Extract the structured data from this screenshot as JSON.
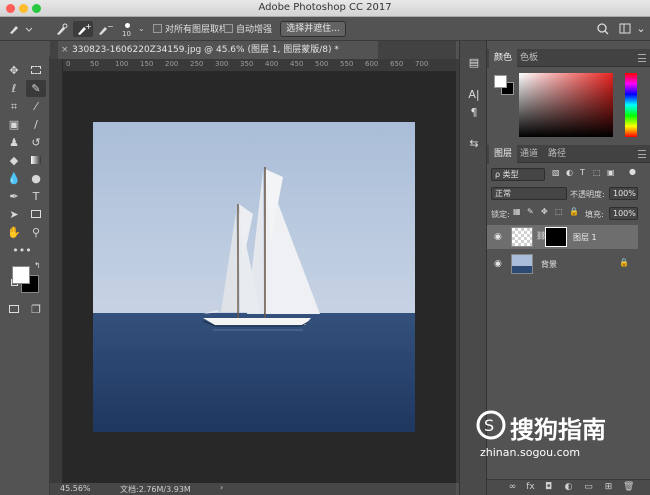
{
  "window": {
    "title": "Adobe Photoshop CC 2017"
  },
  "options_bar": {
    "brush_size": "10",
    "sample_all_layers_label": "对所有图层取样",
    "auto_enhance_label": "自动增强",
    "select_and_mask_label": "选择并遮住..."
  },
  "document": {
    "tab_title": "330823-1606220Z34159.jpg @ 45.6% (图层 1, 图层蒙版/8) *",
    "close_symbol": "×",
    "ruler_top": [
      "0",
      "50",
      "100",
      "150",
      "200",
      "250",
      "300",
      "350",
      "400",
      "450",
      "500",
      "550",
      "600",
      "650",
      "700"
    ]
  },
  "status": {
    "zoom": "45.56%",
    "doc_size": "文档:2.76M/3.93M",
    "arrow": "›"
  },
  "color_panel": {
    "tabs": [
      "颜色",
      "色板"
    ],
    "foreground": "#ffffff",
    "background": "#000000",
    "hue_color": "#e8231f"
  },
  "layers_panel": {
    "tabs": [
      "图层",
      "通道",
      "路径"
    ],
    "filter_label": "ρ 类型",
    "blend_mode": "正常",
    "opacity_label": "不透明度:",
    "opacity_value": "100%",
    "lock_label": "锁定:",
    "fill_label": "填充:",
    "fill_value": "100%",
    "layers": [
      {
        "name": "图层 1",
        "selected": true
      },
      {
        "name": "背景",
        "selected": false
      }
    ],
    "bottom_icons": [
      "∞",
      "fx",
      "◘",
      "◐",
      "▭",
      "⊞",
      "🗑"
    ]
  },
  "watermark": {
    "brand": "搜狗指南",
    "url": "zhinan.sogou.com"
  }
}
